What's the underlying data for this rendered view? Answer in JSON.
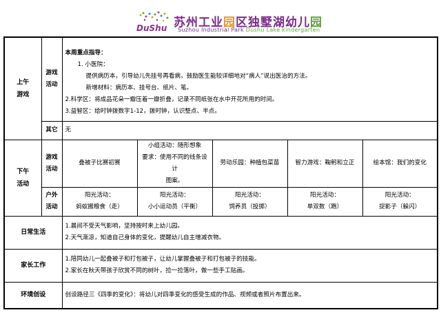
{
  "header": {
    "school_name_cn_1": "苏州工业",
    "school_name_cn_2": "园",
    "school_name_cn_3": "区",
    "school_name_cn_4": "独墅湖幼儿",
    "school_name_cn_5": "园",
    "school_name_en_1": "Suzhou Industrial Park ",
    "school_name_en_2": "Dushu Lake kindergarten",
    "logo_text": "DuShu",
    "colors": {
      "purple": "#7a2a8a",
      "green": "#5aa83a",
      "orange": "#e39a2a"
    }
  },
  "morning": {
    "label_line1": "上午",
    "label_line2": "游戏",
    "game": {
      "label_line1": "游戏",
      "label_line2": "活动",
      "heading": "本周重点指导：",
      "lines": [
        "1. 小医院：",
        "提供病历本，引导幼儿先挂号再看病，鼓励医生能较详细地对“病人”说出医治的方法。",
        "新增材料：病历本、挂号台、纸片、笔。",
        "2.科学区：将成品花朵一瓣压着一瓣折叠，记录不同纸张在水中开花所用的时间。",
        "3.益智区：给时钟拨数字1-12，拨时钟，认识整点、半点。"
      ]
    },
    "other": {
      "label": "其它",
      "value": "无"
    }
  },
  "afternoon": {
    "label_line1": "下午",
    "label_line2": "活动",
    "game": {
      "label_line1": "游戏",
      "label_line2": "活动",
      "cells": [
        {
          "lines": [
            "叠被子比赛初赛"
          ]
        },
        {
          "lines": [
            "小组活动：随形想象",
            "要求：使用不同的线条设计",
            "图案。"
          ]
        },
        {
          "lines": [
            "劳动乐园：种植包菜苗"
          ]
        },
        {
          "lines": [
            "智力游戏：鞠躬和立正"
          ]
        },
        {
          "lines": [
            "绘本馆：我们的变化"
          ]
        }
      ]
    },
    "outdoor": {
      "label_line1": "户外",
      "label_line2": "活动",
      "cells": [
        {
          "lines": [
            "阳光活动：",
            "蚂蚁搬粮食（走）"
          ]
        },
        {
          "lines": [
            "阳光活动：",
            "小小运动员（平衡）"
          ]
        },
        {
          "lines": [
            "阳光活动：",
            "饲养员（投掷）"
          ]
        },
        {
          "lines": [
            "阳光活动：",
            "单双数（跑）"
          ]
        },
        {
          "lines": [
            "阳光活动：",
            "捉影子（躲闪）"
          ]
        }
      ]
    }
  },
  "daily_life": {
    "label": "日常生活",
    "lines": [
      "1.晨间不受天气影响，坚持按时来上幼儿园。",
      "2.天气渐凉，知道自己身体的变化，提醒幼儿自主增减衣物。"
    ]
  },
  "parents": {
    "label": "家长工作",
    "lines": [
      "1.陪同幼儿一起叠被子和打包被子，让幼儿掌握叠被子和打包被子的技能。",
      "2.家长在秋天带孩子欣赏不同的树叶，捡一捡落叶，做一些手工贴画。"
    ]
  },
  "environment": {
    "label": "环境创设",
    "value": "创设路径三《四季的变化》：将幼儿对四季变化的感受生成的作品、视频或者照片布置出来。"
  }
}
